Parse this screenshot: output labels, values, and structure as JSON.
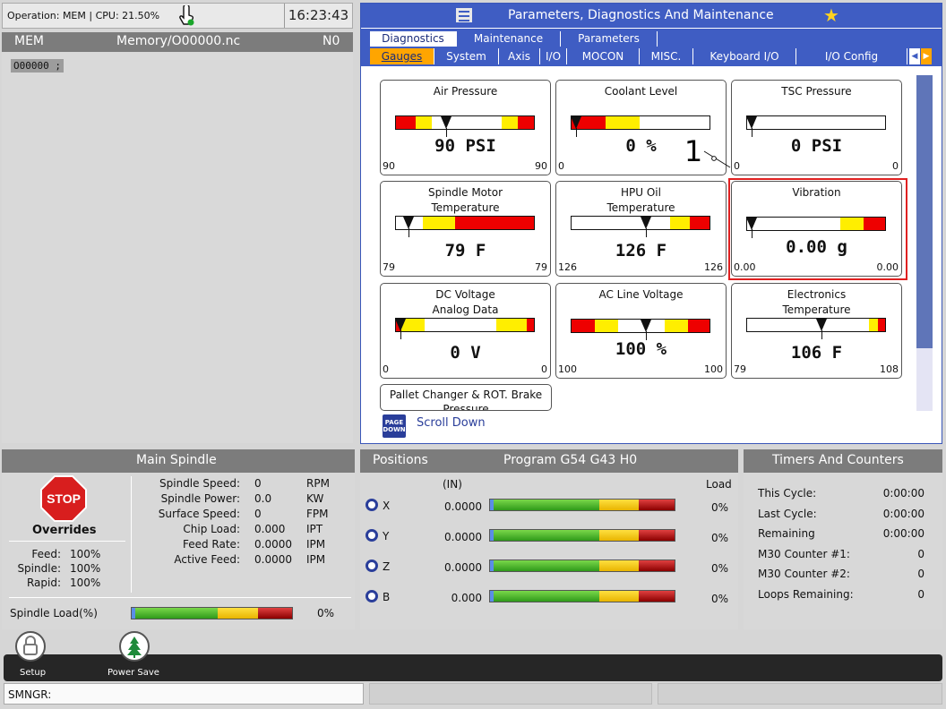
{
  "status": {
    "operation": "Operation: MEM | CPU: 21.50%",
    "clock": "16:23:43"
  },
  "program": {
    "mode": "MEM",
    "file": "Memory/O00000.nc",
    "line_number": "N0",
    "code_line": "O00000 ;"
  },
  "pdm": {
    "title": "Parameters, Diagnostics And Maintenance",
    "tabs": [
      "Diagnostics",
      "Maintenance",
      "Parameters"
    ],
    "subtabs": [
      "Gauges",
      "System",
      "Axis",
      "I/O",
      "MOCON",
      "MISC.",
      "Keyboard I/O",
      "I/O Config"
    ],
    "gauges": [
      {
        "title1": "Air Pressure",
        "title2": "",
        "value": "90 PSI",
        "min": "90",
        "max": "90"
      },
      {
        "title1": "Coolant Level",
        "title2": "",
        "value": "0 %",
        "min": "0",
        "max": ""
      },
      {
        "title1": "TSC Pressure",
        "title2": "",
        "value": "0 PSI",
        "min": "0",
        "max": "0"
      },
      {
        "title1": "Spindle Motor",
        "title2": "Temperature",
        "value": "79 F",
        "min": "79",
        "max": "79"
      },
      {
        "title1": "HPU Oil",
        "title2": "Temperature",
        "value": "126 F",
        "min": "126",
        "max": "126"
      },
      {
        "title1": "Vibration",
        "title2": "",
        "value": "0.00 g",
        "min": "0.00",
        "max": "0.00"
      },
      {
        "title1": "DC Voltage",
        "title2": "Analog Data",
        "value": "0 V",
        "min": "0",
        "max": "0"
      },
      {
        "title1": "AC Line Voltage",
        "title2": "",
        "value": "100 %",
        "min": "100",
        "max": "100"
      },
      {
        "title1": "Electronics",
        "title2": "Temperature",
        "value": "106 F",
        "min": "79",
        "max": "108"
      }
    ],
    "pallet_title1": "Pallet Changer & ROT. Brake",
    "pallet_title2": "Pressure",
    "page_down_icon": "PAGE DOWN",
    "scroll_down": "Scroll Down",
    "callout": "1"
  },
  "spindle": {
    "title": "Main Spindle",
    "stop": "STOP",
    "overrides": "Overrides",
    "override_labels": [
      "Feed:",
      "Spindle:",
      "Rapid:"
    ],
    "override_values": [
      "100%",
      "100%",
      "100%"
    ],
    "stat_labels": [
      "Spindle Speed:",
      "Spindle Power:",
      "Surface Speed:",
      "Chip Load:",
      "Feed Rate:",
      "Active Feed:"
    ],
    "stat_values": [
      "0",
      "0.0",
      "0",
      "0.000",
      "0.0000",
      "0.0000"
    ],
    "stat_units": [
      "RPM",
      "KW",
      "FPM",
      "IPT",
      "IPM",
      "IPM"
    ],
    "load_label": "Spindle Load(%)",
    "load_value": "0%"
  },
  "positions": {
    "title": "Positions",
    "program": "Program G54 G43 H0",
    "unit": "(IN)",
    "load_header": "Load",
    "axes": [
      {
        "name": "X",
        "value": "0.0000",
        "load": "0%"
      },
      {
        "name": "Y",
        "value": "0.0000",
        "load": "0%"
      },
      {
        "name": "Z",
        "value": "0.0000",
        "load": "0%"
      },
      {
        "name": "B",
        "value": "0.000",
        "load": "0%"
      }
    ]
  },
  "timers": {
    "title": "Timers And Counters",
    "labels": [
      "This Cycle:",
      "Last Cycle:",
      "Remaining",
      "M30 Counter #1:",
      "M30 Counter #2:",
      "Loops Remaining:"
    ],
    "values": [
      "0:00:00",
      "0:00:00",
      "0:00:00",
      "0",
      "0",
      "0"
    ]
  },
  "toolbar": {
    "setup": "Setup",
    "power_save": "Power Save"
  },
  "statusbar": {
    "text": "SMNGR:"
  }
}
